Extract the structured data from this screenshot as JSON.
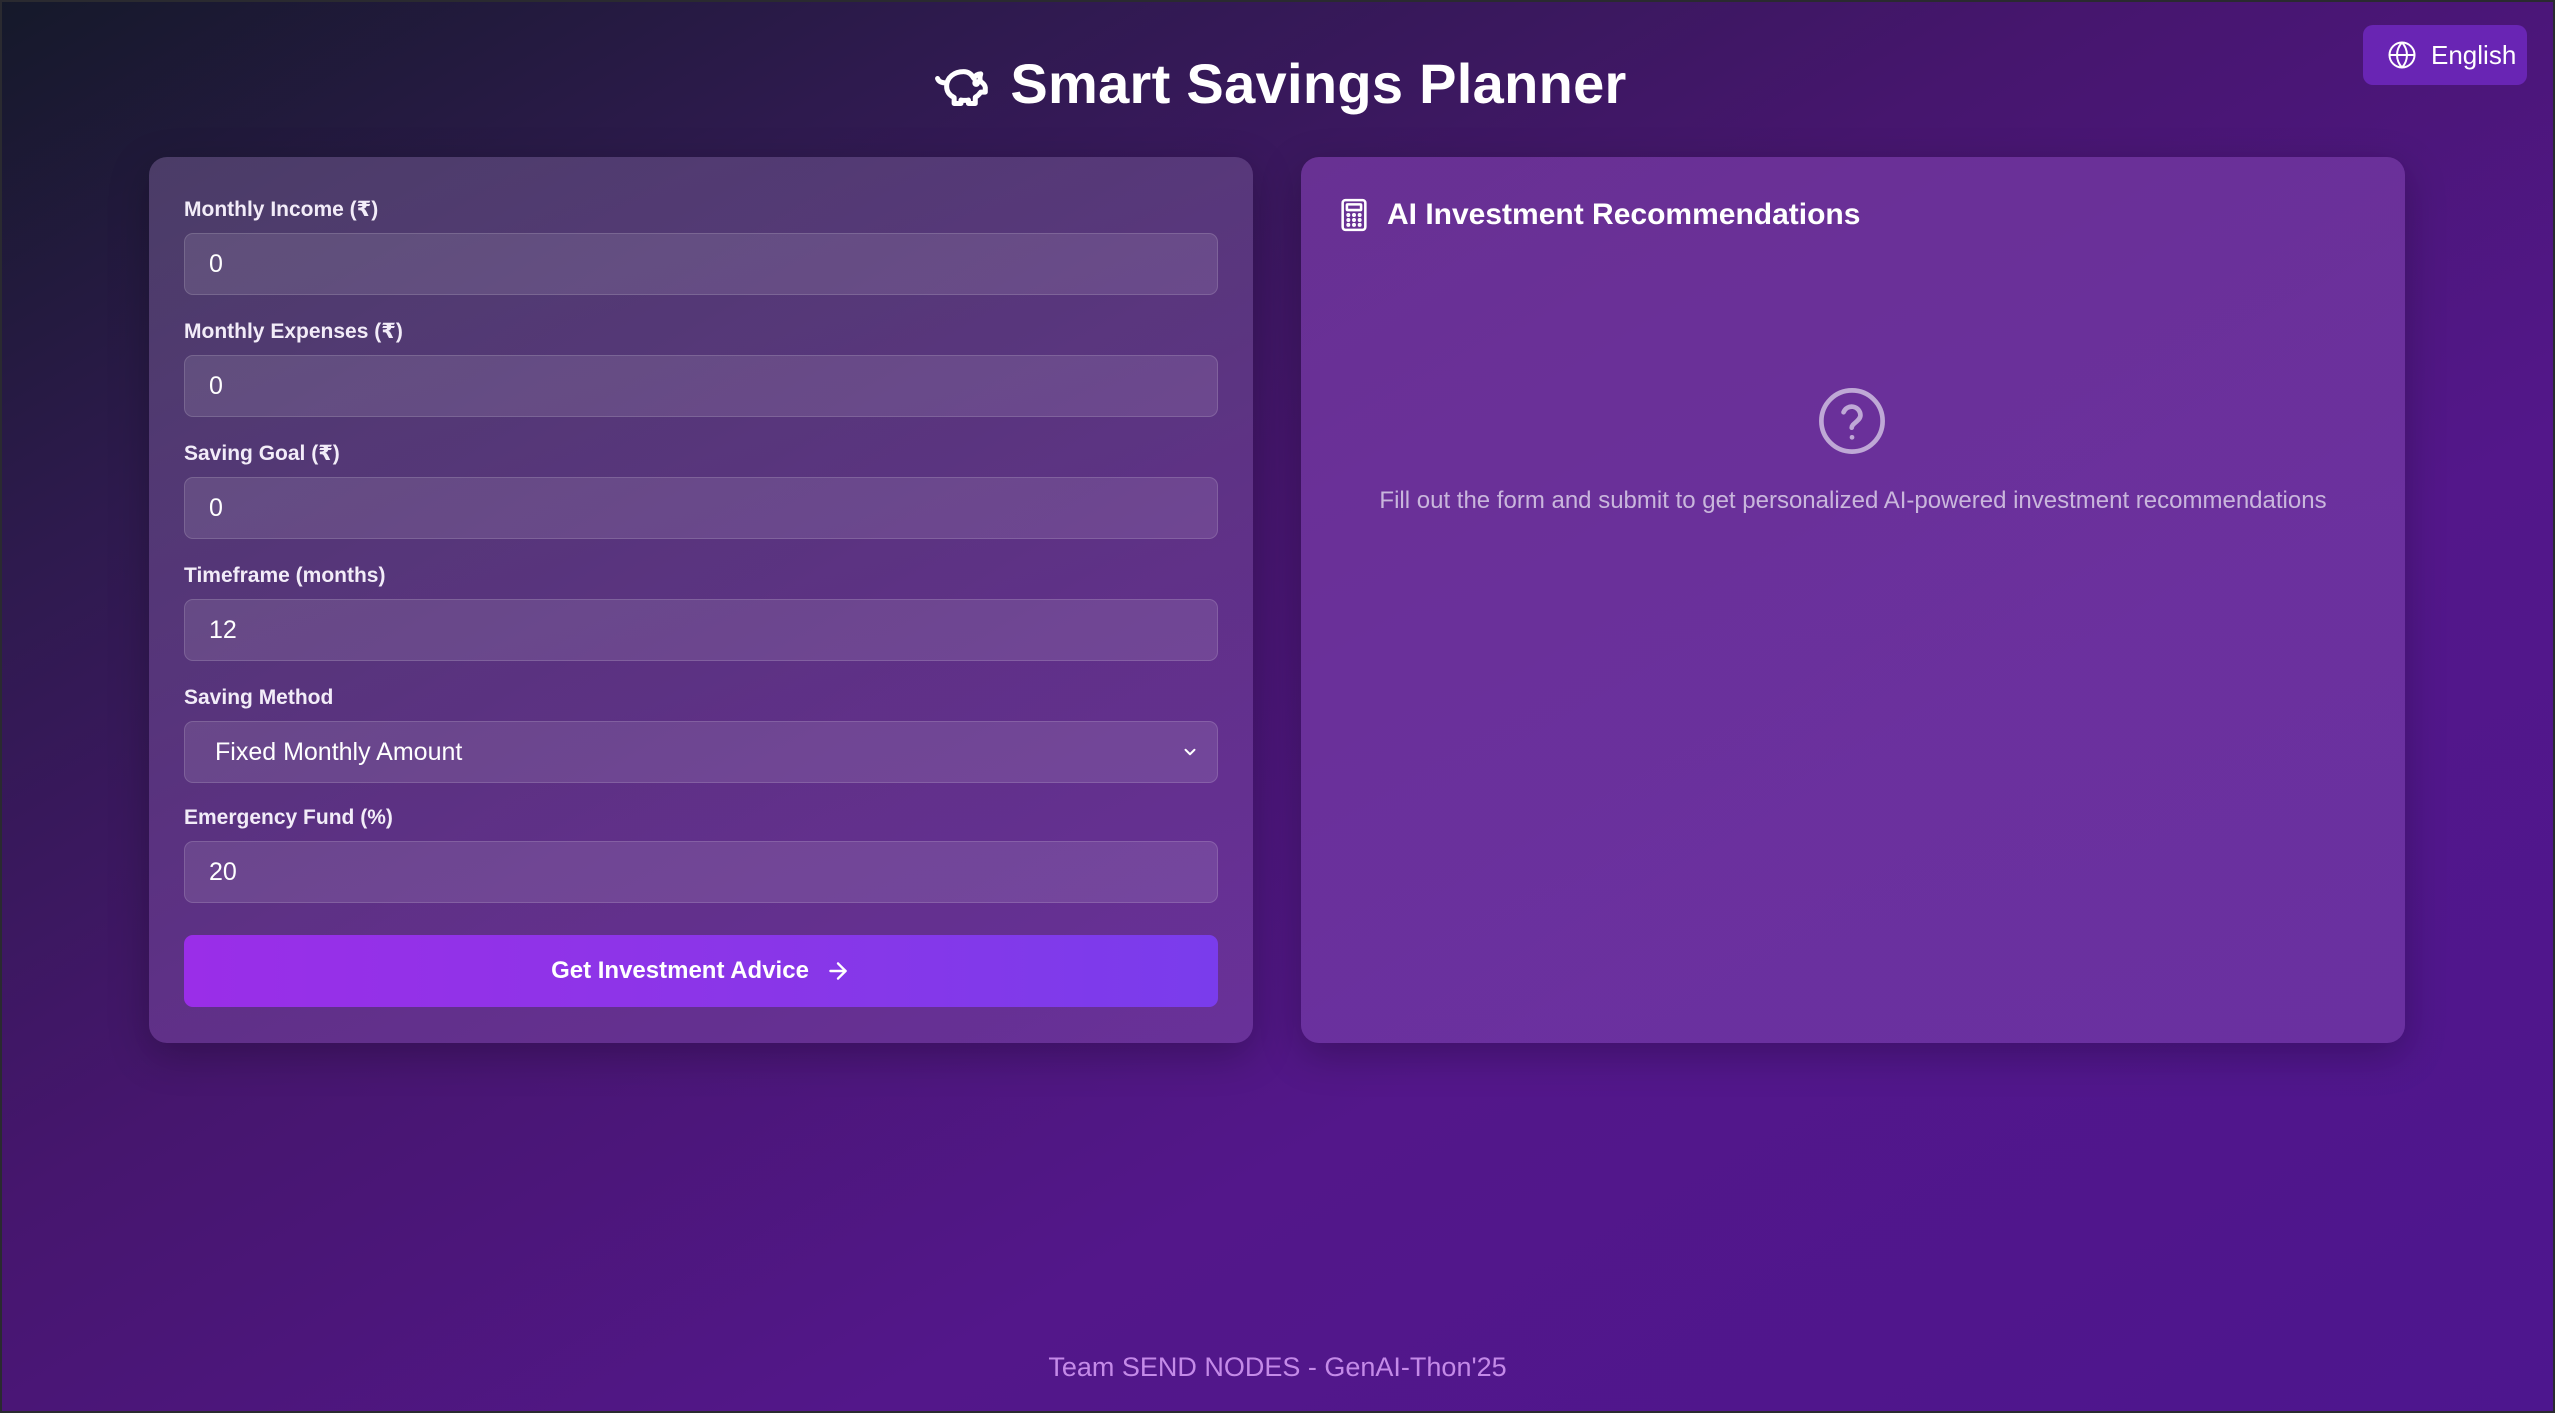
{
  "header": {
    "title": "Smart Savings Planner",
    "title_icon": "piggy-bank-icon",
    "language_label": "English",
    "language_icon": "globe-icon"
  },
  "form": {
    "monthly_income": {
      "label": "Monthly Income (₹)",
      "value": "0"
    },
    "monthly_expenses": {
      "label": "Monthly Expenses (₹)",
      "value": "0"
    },
    "saving_goal": {
      "label": "Saving Goal (₹)",
      "value": "0"
    },
    "timeframe": {
      "label": "Timeframe (months)",
      "value": "12"
    },
    "saving_method": {
      "label": "Saving Method",
      "value": "Fixed Monthly Amount"
    },
    "emergency_fund": {
      "label": "Emergency Fund (%)",
      "value": "20"
    },
    "submit_label": "Get Investment Advice"
  },
  "recommendations": {
    "title": "AI Investment Recommendations",
    "title_icon": "calculator-icon",
    "empty_icon": "help-circle-icon",
    "empty_message": "Fill out the form and submit to get personalized AI-powered investment recommendations"
  },
  "footer": {
    "text": "Team SEND NODES - GenAI-Thon'25"
  },
  "colors": {
    "accent": "#9a2ee8",
    "language_button": "#6e28be",
    "footer_text": "#c48ae8"
  }
}
